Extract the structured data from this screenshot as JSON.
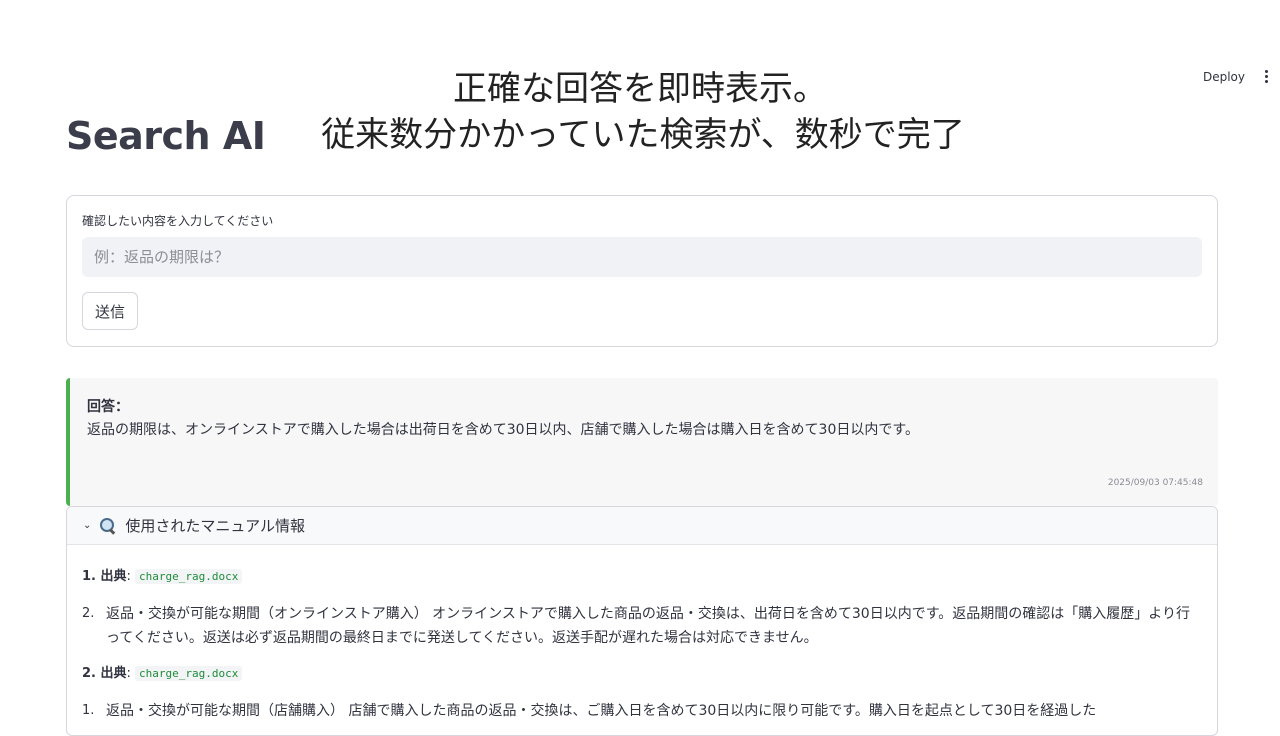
{
  "topbar": {
    "deploy_label": "Deploy"
  },
  "caption": {
    "line1": "正確な回答を即時表示。",
    "line2": "従来数分かかっていた検索が、数秒で完了"
  },
  "page": {
    "title": "Search AI"
  },
  "form": {
    "label": "確認したい内容を入力してください",
    "placeholder": "例：返品の期限は？",
    "value": "",
    "submit_label": "送信"
  },
  "answer": {
    "heading": "回答：",
    "text": "返品の期限は、オンラインストアで購入した場合は出荷日を含めて30日以内、店舗で購入した場合は購入日を含めて30日以内です。",
    "timestamp": "2025/09/03 07:45:48",
    "accent_color": "#4caf50"
  },
  "manual": {
    "expander_label": "使用されたマニュアル情報",
    "icon": "magnifier-icon",
    "sources": [
      {
        "index": "1. 出典",
        "file": "charge_rag.docx",
        "item_num": "2.",
        "content": "返品・交換が可能な期間（オンラインストア購入） オンラインストアで購入した商品の返品・交換は、出荷日を含めて30日以内です。返品期間の確認は「購入履歴」より行ってください。返送は必ず返品期間の最終日までに発送してください。返送手配が遅れた場合は対応できません。"
      },
      {
        "index": "2. 出典",
        "file": "charge_rag.docx",
        "item_num": "1.",
        "content": "返品・交換が可能な期間（店舗購入） 店舗で購入した商品の返品・交換は、ご購入日を含めて30日以内に限り可能です。購入日を起点として30日を経過した"
      }
    ]
  }
}
